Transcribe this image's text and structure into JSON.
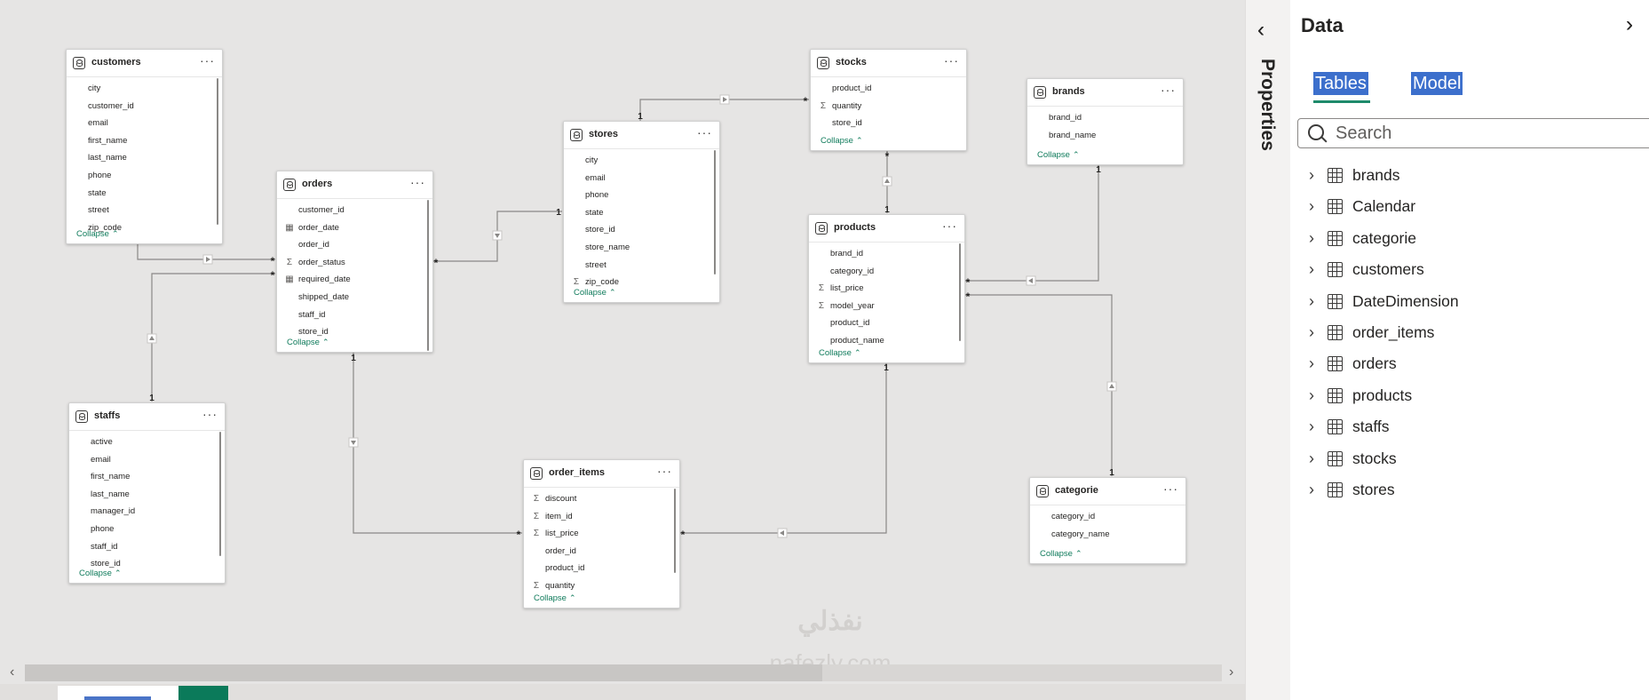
{
  "canvas": {
    "cards": [
      {
        "key": "customers",
        "title": "customers",
        "more": "···",
        "collapse": "Collapse",
        "fields": [
          {
            "name": "city",
            "icon": ""
          },
          {
            "name": "customer_id",
            "icon": ""
          },
          {
            "name": "email",
            "icon": ""
          },
          {
            "name": "first_name",
            "icon": ""
          },
          {
            "name": "last_name",
            "icon": ""
          },
          {
            "name": "phone",
            "icon": ""
          },
          {
            "name": "state",
            "icon": ""
          },
          {
            "name": "street",
            "icon": ""
          },
          {
            "name": "zip_code",
            "icon": ""
          }
        ]
      },
      {
        "key": "orders",
        "title": "orders",
        "more": "···",
        "collapse": "Collapse",
        "fields": [
          {
            "name": "customer_id",
            "icon": ""
          },
          {
            "name": "order_date",
            "icon": "calendar"
          },
          {
            "name": "order_id",
            "icon": ""
          },
          {
            "name": "order_status",
            "icon": "sigma"
          },
          {
            "name": "required_date",
            "icon": "calendar"
          },
          {
            "name": "shipped_date",
            "icon": ""
          },
          {
            "name": "staff_id",
            "icon": ""
          },
          {
            "name": "store_id",
            "icon": ""
          }
        ]
      },
      {
        "key": "stores",
        "title": "stores",
        "more": "···",
        "collapse": "Collapse",
        "fields": [
          {
            "name": "city",
            "icon": ""
          },
          {
            "name": "email",
            "icon": ""
          },
          {
            "name": "phone",
            "icon": ""
          },
          {
            "name": "state",
            "icon": ""
          },
          {
            "name": "store_id",
            "icon": ""
          },
          {
            "name": "store_name",
            "icon": ""
          },
          {
            "name": "street",
            "icon": ""
          },
          {
            "name": "zip_code",
            "icon": "sigma"
          }
        ]
      },
      {
        "key": "stocks",
        "title": "stocks",
        "more": "···",
        "collapse": "Collapse",
        "fields": [
          {
            "name": "product_id",
            "icon": ""
          },
          {
            "name": "quantity",
            "icon": "sigma"
          },
          {
            "name": "store_id",
            "icon": ""
          }
        ]
      },
      {
        "key": "brands",
        "title": "brands",
        "more": "···",
        "collapse": "Collapse",
        "fields": [
          {
            "name": "brand_id",
            "icon": ""
          },
          {
            "name": "brand_name",
            "icon": ""
          }
        ]
      },
      {
        "key": "products",
        "title": "products",
        "more": "···",
        "collapse": "Collapse",
        "fields": [
          {
            "name": "brand_id",
            "icon": ""
          },
          {
            "name": "category_id",
            "icon": ""
          },
          {
            "name": "list_price",
            "icon": "sigma"
          },
          {
            "name": "model_year",
            "icon": "sigma"
          },
          {
            "name": "product_id",
            "icon": ""
          },
          {
            "name": "product_name",
            "icon": ""
          }
        ]
      },
      {
        "key": "staffs",
        "title": "staffs",
        "more": "···",
        "collapse": "Collapse",
        "fields": [
          {
            "name": "active",
            "icon": ""
          },
          {
            "name": "email",
            "icon": ""
          },
          {
            "name": "first_name",
            "icon": ""
          },
          {
            "name": "last_name",
            "icon": ""
          },
          {
            "name": "manager_id",
            "icon": ""
          },
          {
            "name": "phone",
            "icon": ""
          },
          {
            "name": "staff_id",
            "icon": ""
          },
          {
            "name": "store_id",
            "icon": ""
          }
        ]
      },
      {
        "key": "order_items",
        "title": "order_items",
        "more": "···",
        "collapse": "Collapse",
        "fields": [
          {
            "name": "discount",
            "icon": "sigma"
          },
          {
            "name": "item_id",
            "icon": "sigma"
          },
          {
            "name": "list_price",
            "icon": "sigma"
          },
          {
            "name": "order_id",
            "icon": ""
          },
          {
            "name": "product_id",
            "icon": ""
          },
          {
            "name": "quantity",
            "icon": "sigma"
          }
        ]
      },
      {
        "key": "categorie",
        "title": "categorie",
        "more": "···",
        "collapse": "Collapse",
        "fields": [
          {
            "name": "category_id",
            "icon": ""
          },
          {
            "name": "category_name",
            "icon": ""
          }
        ]
      }
    ],
    "relationships": [
      {
        "from": "customers",
        "to": "orders",
        "from_cardinality": "1",
        "to_cardinality": "*"
      },
      {
        "from": "staffs",
        "to": "orders",
        "from_cardinality": "1",
        "to_cardinality": "*"
      },
      {
        "from": "stores",
        "to": "orders",
        "from_cardinality": "1",
        "to_cardinality": "*"
      },
      {
        "from": "stores",
        "to": "stocks",
        "from_cardinality": "1",
        "to_cardinality": "*"
      },
      {
        "from": "products",
        "to": "stocks",
        "from_cardinality": "1",
        "to_cardinality": "*"
      },
      {
        "from": "brands",
        "to": "products",
        "from_cardinality": "1",
        "to_cardinality": "*"
      },
      {
        "from": "categorie",
        "to": "products",
        "from_cardinality": "1",
        "to_cardinality": "*"
      },
      {
        "from": "orders",
        "to": "order_items",
        "from_cardinality": "1",
        "to_cardinality": "*"
      },
      {
        "from": "products",
        "to": "order_items",
        "from_cardinality": "1",
        "to_cardinality": "*"
      }
    ],
    "watermark": {
      "line1": "نفذلي",
      "line2": "nafezly.com"
    }
  },
  "properties_pane": {
    "label": "Properties",
    "collapse_icon": "chevron-double-left-icon"
  },
  "data_pane": {
    "title": "Data",
    "expand_icon": "chevron-double-right-icon",
    "tabs": [
      {
        "label": "Tables",
        "selected": true
      },
      {
        "label": "Model",
        "selected": false
      }
    ],
    "search": {
      "placeholder": "Search",
      "value": ""
    },
    "tables": [
      "brands",
      "Calendar",
      "categorie",
      "customers",
      "DateDimension",
      "order_items",
      "orders",
      "products",
      "staffs",
      "stocks",
      "stores"
    ]
  },
  "colors": {
    "accent": "#0f7b5b",
    "selection": "#3c6fcc",
    "canvas": "#e6e5e4"
  }
}
